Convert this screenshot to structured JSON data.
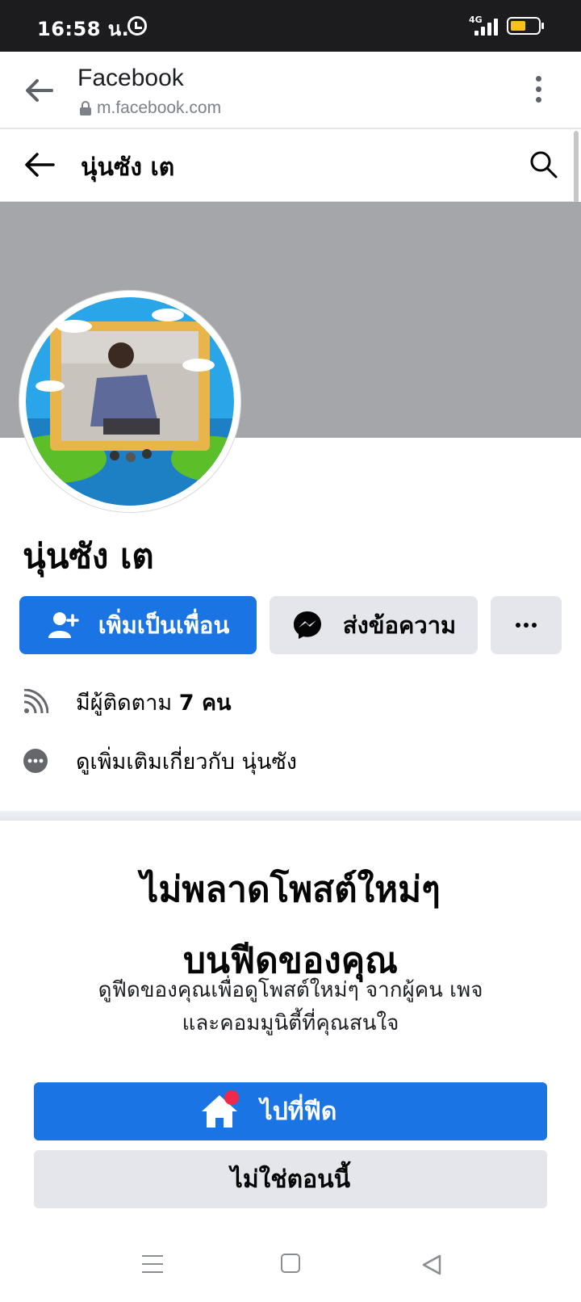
{
  "status_bar": {
    "time": "16:58 น.",
    "network": "4G",
    "battery_level": 0.55,
    "battery_color": "#f7c31b"
  },
  "browser": {
    "title": "Facebook",
    "url": "m.facebook.com",
    "icons": [
      "back-arrow-icon",
      "lock-icon",
      "more-vert-icon"
    ]
  },
  "header": {
    "name": "นุ่นซัง เต",
    "icons": [
      "back-arrow-icon",
      "search-icon"
    ]
  },
  "profile": {
    "name": "นุ่นซัง เต",
    "cover_color": "#a4a6aa"
  },
  "actions": {
    "add_friend_label": "เพิ่มเป็นเพื่อน",
    "message_label": "ส่งข้อความ",
    "more_icon": "more-horizontal-icon",
    "accent": "#1b74e4"
  },
  "info": {
    "followers_prefix": "มีผู้ติดตาม",
    "followers_count": "7 คน",
    "about_text": "ดูเพิ่มเติมเกี่ยวกับ นุ่นซัง"
  },
  "promo": {
    "title_line1": "ไม่พลาดโพสต์ใหม่ๆ",
    "title_line2": "บนฟีดของคุณ",
    "desc_line1": "ดูฟีดของคุณเพื่อดูโพสต์ใหม่ๆ จากผู้คน เพจ",
    "desc_line2": "และคอมมูนิตี้ที่คุณสนใจ",
    "go_feed_label": "ไปที่ฟีด",
    "not_now_label": "ไม่ใช่ตอนนี้",
    "notification_color": "#f02849"
  },
  "nav": {
    "icons": [
      "recent-apps-icon",
      "home-icon",
      "back-triangle-icon"
    ]
  }
}
